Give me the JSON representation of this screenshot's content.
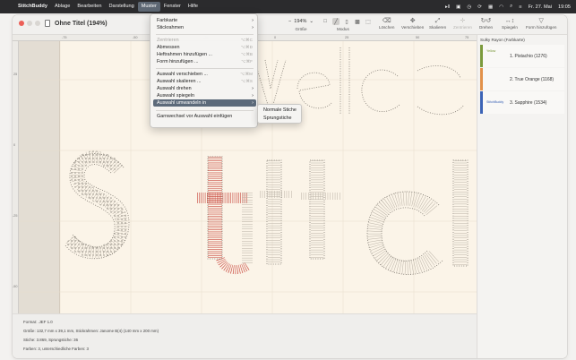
{
  "menubar": {
    "app": "StitchBuddy",
    "items": [
      "Ablage",
      "Bearbeiten",
      "Darstellung",
      "Muster",
      "Fenster",
      "Hilfe"
    ],
    "active": "Muster",
    "date": "Fr. 27. Mai",
    "time": "19:05"
  },
  "window": {
    "title": "Ohne Titel (194%)"
  },
  "toolbar": {
    "zoom_value": "194%",
    "zoom_label": "Größe",
    "modus_label": "Modus",
    "loeschen": "Löschen",
    "verschieben": "Verschieben",
    "skalieren": "Skalieren",
    "zentrieren": "Zentrieren",
    "drehen": "Drehen",
    "spiegeln": "Spiegeln",
    "form_hinzufuegen": "Form hinzufügen"
  },
  "ruler": {
    "top": [
      "-75",
      "-50",
      "-25",
      "0",
      "25",
      "50",
      "75"
    ],
    "left": [
      "25",
      "0",
      "-25",
      "-50",
      "-75"
    ]
  },
  "muster_menu": {
    "items": [
      {
        "label": "Farbkarte",
        "submenu": true
      },
      {
        "label": "Stickrahmen",
        "submenu": true
      },
      {
        "label": "Zentrieren",
        "shortcut": "⌥⌘C",
        "disabled": true
      },
      {
        "label": "Abmessen",
        "shortcut": "⌥⌘D"
      },
      {
        "label": "Heftrahmen hinzufügen ...",
        "shortcut": "⌥⌘B"
      },
      {
        "label": "Form hinzufügen ...",
        "shortcut": "⌥⌘F"
      },
      {
        "label": "Auswahl verschieben ...",
        "shortcut": "⌥⌘M"
      },
      {
        "label": "Auswahl skalieren ...",
        "shortcut": "⌥⌘S"
      },
      {
        "label": "Auswahl drehen",
        "submenu": true
      },
      {
        "label": "Auswahl spiegeln",
        "submenu": true
      },
      {
        "label": "Auswahl umwandeln in",
        "submenu": true,
        "selected": true
      },
      {
        "label": "Garnwechsel vor Auswahl einfügen"
      }
    ]
  },
  "umwandeln_submenu": {
    "items": [
      "Normale Stiche",
      "Sprungstiche"
    ]
  },
  "panel": {
    "title": "Sulky Rayon (Farbkarte)",
    "swatches": [
      {
        "label": "1. Pistachio (1276)",
        "color": "#7b9a3c",
        "mini": "Yellow"
      },
      {
        "label": "2. True Orange (1168)",
        "color": "#e2914a",
        "mini": ""
      },
      {
        "label": "3. Sapphire (1534)",
        "color": "#3b63b6",
        "mini": "StitchBuddy"
      }
    ]
  },
  "info": {
    "format": "Format: .JEF 1.0",
    "groesse": "Größe: 132,7 mm x 39,1 mm, Stickrahmen: Janome B(4) (140 mm x 200 mm)",
    "stiche": "Stiche: 3.869, Sprungstiche: 36",
    "farben": "Farben: 3, unterschiedliche Farben: 3"
  },
  "colors": {
    "menubar": "#2b2b2d",
    "selection": "#5c6a7a",
    "canvas": "#fbf4e8",
    "stitch": "#9b948a",
    "stitch_red": "#c8443a"
  }
}
